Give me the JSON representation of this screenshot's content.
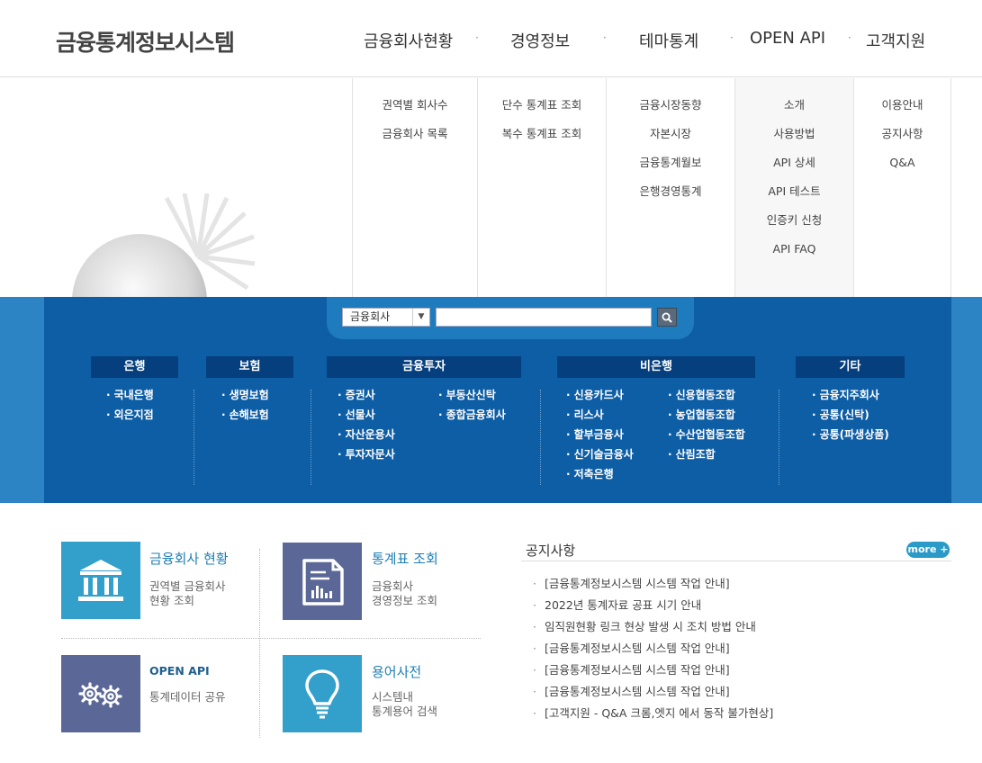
{
  "header": {
    "logo": "금융통계정보시스템",
    "nav": [
      {
        "label": "금융회사현황"
      },
      {
        "label": "경영정보"
      },
      {
        "label": "테마통계"
      },
      {
        "label": "OPEN API"
      },
      {
        "label": "고객지원"
      }
    ],
    "nav_separator": "·"
  },
  "mega_menu": [
    {
      "items": [
        "권역별 회사수",
        "금융회사 목록"
      ]
    },
    {
      "items": [
        "단수 통계표 조회",
        "복수 통계표 조회"
      ]
    },
    {
      "items": [
        "금융시장동향",
        "자본시장",
        "금융통계월보",
        "은행경영통계"
      ]
    },
    {
      "items": [
        "소개",
        "사용방법",
        "API 상세",
        "API 테스트",
        "인증키 신청",
        "API FAQ"
      ]
    },
    {
      "items": [
        "이용안내",
        "공지사항",
        "Q&A"
      ]
    }
  ],
  "search": {
    "select_value": "금융회사",
    "select_arrow": "▼",
    "input_value": "",
    "button_icon": "magnifier-icon"
  },
  "categories": [
    {
      "title": "은행",
      "cols": [
        [
          "국내은행",
          "외은지점"
        ]
      ]
    },
    {
      "title": "보험",
      "cols": [
        [
          "생명보험",
          "손해보험"
        ]
      ]
    },
    {
      "title": "금융투자",
      "cols": [
        [
          "증권사",
          "선물사",
          "자산운용사",
          "투자자문사"
        ],
        [
          "부동산신탁",
          "종합금융회사"
        ]
      ]
    },
    {
      "title": "비은행",
      "cols": [
        [
          "신용카드사",
          "리스사",
          "할부금융사",
          "신기술금융사",
          "저축은행"
        ],
        [
          "신용협동조합",
          "농업협동조합",
          "수산업협동조합",
          "산림조합"
        ]
      ]
    },
    {
      "title": "기타",
      "cols": [
        [
          "금융지주회사",
          "공통(신탁)",
          "공통(파생상품)"
        ]
      ]
    }
  ],
  "quick_links": [
    {
      "title": "금융회사 현황",
      "desc1": "권역별 금융회사",
      "desc2": "현황 조회",
      "icon": "bank-icon",
      "color": "#33a0cc"
    },
    {
      "title": "통계표 조회",
      "desc1": "금융회사",
      "desc2": "경영정보 조회",
      "icon": "document-chart-icon",
      "color": "#5b6897"
    },
    {
      "title": "OPEN API",
      "desc1": "통계데이터 공유",
      "desc2": "",
      "icon": "gears-icon",
      "color": "#5b6897"
    },
    {
      "title": "용어사전",
      "desc1": "시스템내",
      "desc2": "통계용어 검색",
      "icon": "lightbulb-icon",
      "color": "#33a0cc"
    }
  ],
  "notice": {
    "title": "공지사항",
    "more_label": "more +",
    "bullet": "·",
    "items": [
      "[금융통계정보시스템 시스템 작업 안내]",
      "2022년 통계자료 공표 시기 안내",
      "임직원현황 링크 현상 발생 시 조치 방법 안내",
      "[금융통계정보시스템 시스템 작업 안내]",
      "[금융통계정보시스템 시스템 작업 안내]",
      "[금융통계정보시스템 시스템 작업 안내]",
      "[고객지원 - Q&A 크롬,엣지 에서 동작 불가현상]"
    ]
  }
}
